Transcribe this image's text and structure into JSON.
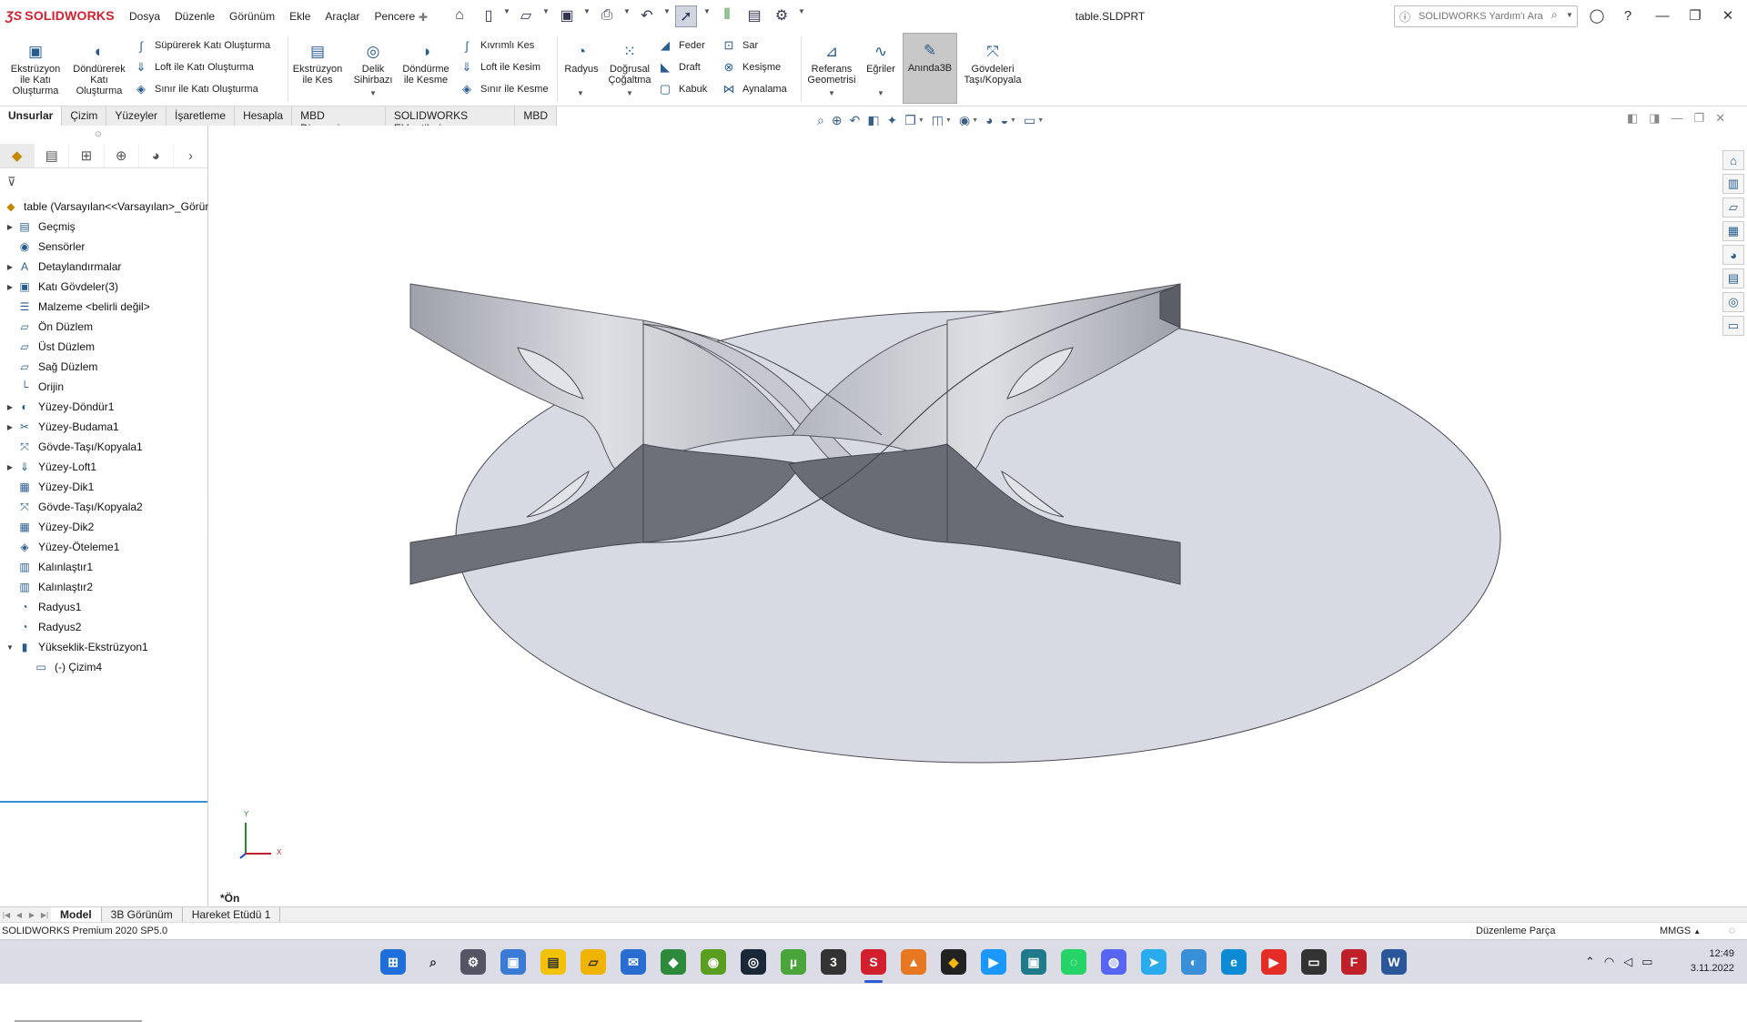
{
  "app": {
    "brand": "SOLIDWORKS",
    "document_title": "table.SLDPRT",
    "menus": [
      "Dosya",
      "Düzenle",
      "Görünüm",
      "Ekle",
      "Araçlar",
      "Pencere"
    ],
    "help_search_placeholder": "SOLIDWORKS Yardım'ı Ara"
  },
  "commands": {
    "extrude_boss": "Ekstrüzyon ile Katı Oluşturma",
    "revolve_boss": "Döndürerek Katı Oluşturma",
    "sweep_boss": "Süpürerek Katı Oluşturma",
    "loft_boss": "Loft ile Katı Oluşturma",
    "boundary_boss": "Sınır ile Katı Oluşturma",
    "extrude_cut": "Ekstrüzyon ile Kes",
    "hole_wizard": "Delik Sihirbazı",
    "revolve_cut": "Döndürme ile Kesme",
    "swept_cut": "Kıvrımlı Kes",
    "loft_cut": "Loft ile Kesim",
    "boundary_cut": "Sınır ile Kesme",
    "fillet": "Radyus",
    "linear_pattern": "Doğrusal Çoğaltma",
    "rib": "Feder",
    "draft": "Draft",
    "shell": "Kabuk",
    "wrap": "Sar",
    "intersect": "Kesişme",
    "mirror": "Aynalama",
    "ref_geometry": "Referans Geometrisi",
    "curves": "Eğriler",
    "instant3d": "Anında3B",
    "move_copy_bodies": "Gövdeleri Taşı/Kopyala"
  },
  "tabs": [
    "Unsurlar",
    "Çizim",
    "Yüzeyler",
    "İşaretleme",
    "Hesapla",
    "MBD Dimensions",
    "SOLIDWORKS Eklentileri",
    "MBD"
  ],
  "tree": {
    "root": "table  (Varsayılan<<Varsayılan>_Görün",
    "items": [
      {
        "label": "Geçmiş",
        "icon": "history-folder-icon",
        "glyph": "▤",
        "expand": true
      },
      {
        "label": "Sensörler",
        "icon": "sensors-icon",
        "glyph": "◉",
        "expand": false
      },
      {
        "label": "Detaylandırmalar",
        "icon": "annotations-icon",
        "glyph": "A",
        "expand": true
      },
      {
        "label": "Katı Gövdeler(3)",
        "icon": "solid-bodies-icon",
        "glyph": "▣",
        "expand": true
      },
      {
        "label": "Malzeme <belirli değil>",
        "icon": "material-icon",
        "glyph": "☰",
        "expand": false
      },
      {
        "label": "Ön Düzlem",
        "icon": "plane-icon",
        "glyph": "▱",
        "expand": false
      },
      {
        "label": "Üst Düzlem",
        "icon": "plane-icon",
        "glyph": "▱",
        "expand": false
      },
      {
        "label": "Sağ Düzlem",
        "icon": "plane-icon",
        "glyph": "▱",
        "expand": false
      },
      {
        "label": "Orijin",
        "icon": "origin-icon",
        "glyph": "└",
        "expand": false
      },
      {
        "label": "Yüzey-Döndür1",
        "icon": "surface-revolve-icon",
        "glyph": "◐",
        "expand": true
      },
      {
        "label": "Yüzey-Budama1",
        "icon": "surface-trim-icon",
        "glyph": "✂",
        "expand": true
      },
      {
        "label": "Gövde-Taşı/Kopyala1",
        "icon": "move-copy-icon",
        "glyph": "⤧",
        "expand": false
      },
      {
        "label": "Yüzey-Loft1",
        "icon": "surface-loft-icon",
        "glyph": "⇓",
        "expand": true
      },
      {
        "label": "Yüzey-Dik1",
        "icon": "surface-knit-icon",
        "glyph": "▦",
        "expand": false
      },
      {
        "label": "Gövde-Taşı/Kopyala2",
        "icon": "move-copy-icon",
        "glyph": "⤧",
        "expand": false
      },
      {
        "label": "Yüzey-Dik2",
        "icon": "surface-knit-icon",
        "glyph": "▦",
        "expand": false
      },
      {
        "label": "Yüzey-Öteleme1",
        "icon": "surface-offset-icon",
        "glyph": "◈",
        "expand": false
      },
      {
        "label": "Kalınlaştır1",
        "icon": "thicken-icon",
        "glyph": "▥",
        "expand": false
      },
      {
        "label": "Kalınlaştır2",
        "icon": "thicken-icon",
        "glyph": "▥",
        "expand": false
      },
      {
        "label": "Radyus1",
        "icon": "fillet-icon",
        "glyph": "◔",
        "expand": false
      },
      {
        "label": "Radyus2",
        "icon": "fillet-icon",
        "glyph": "◔",
        "expand": false
      },
      {
        "label": "Yükseklik-Ekstrüzyon1",
        "icon": "boss-extrude-icon",
        "glyph": "▮",
        "expand": "open"
      },
      {
        "label": "(-) Çizim4",
        "icon": "sketch-icon",
        "glyph": "▭",
        "expand": "child"
      }
    ]
  },
  "viewport": {
    "view_label": "*Ön",
    "triad_y": "Y",
    "triad_x": "X"
  },
  "bottom_tabs": [
    "Model",
    "3B Görünüm",
    "Hareket Etüdü 1"
  ],
  "status": {
    "product": "SOLIDWORKS Premium 2020 SP5.0",
    "mode": "Düzenleme Parça",
    "units": "MMGS"
  },
  "clock": {
    "time": "12:49",
    "date": "3.11.2022"
  },
  "colors": {
    "brand_red": "#d2202f",
    "accent_blue": "#2a5d8f",
    "selection_blue": "#3b8fd9",
    "model_dark": "#6b6d78",
    "model_light": "#c4c5cc",
    "tabletop": "#d8dae3"
  }
}
